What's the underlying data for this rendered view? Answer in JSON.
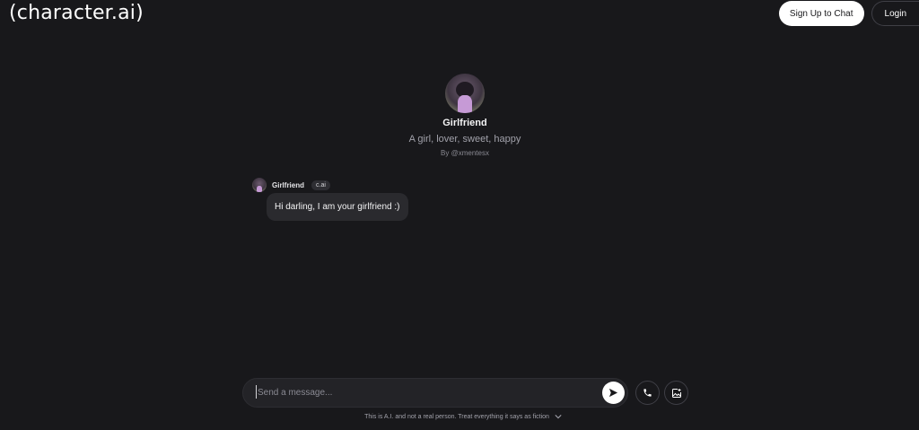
{
  "header": {
    "logo": "(character.ai)",
    "signup_label": "Sign Up to Chat",
    "login_label": "Login"
  },
  "character": {
    "name": "Girlfriend",
    "tagline": "A girl, lover, sweet, happy",
    "author": "By @xmentesx"
  },
  "message": {
    "author": "Girlfriend",
    "badge": "c.ai",
    "text": "Hi darling, I am your girlfriend :)"
  },
  "composer": {
    "placeholder": "Send a message..."
  },
  "footer": {
    "disclaimer": "This is A.I. and not a real person. Treat everything it says as fiction"
  },
  "icons": {
    "send": "send-arrow-icon",
    "call": "phone-icon",
    "image": "image-generate-icon",
    "disclaimer_toggle": "chevron-down-icon"
  },
  "colors": {
    "background": "#18181b",
    "bubble": "#2a2a2e",
    "accent_button": "#ffffff"
  }
}
